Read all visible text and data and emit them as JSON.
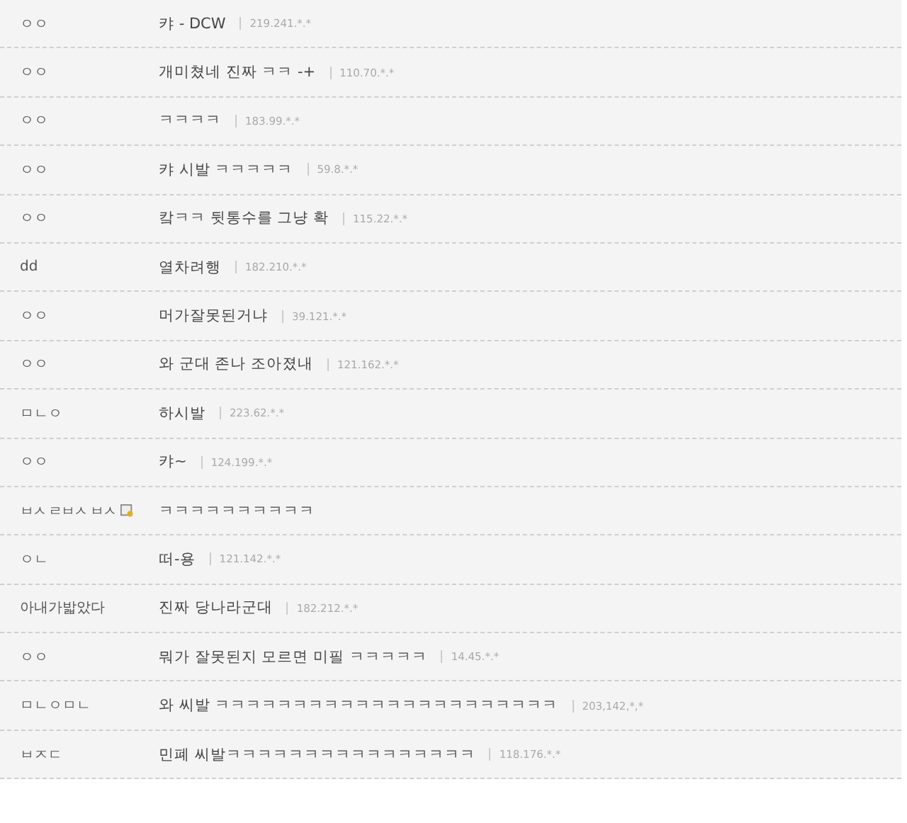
{
  "comments": [
    {
      "nickname": "ㅇㅇ",
      "text": "캬 - DCW",
      "ip": "219.241.*.*"
    },
    {
      "nickname": "ㅇㅇ",
      "text": "개미쳤네 진짜 ㅋㅋ -+",
      "ip": "110.70.*.*"
    },
    {
      "nickname": "ㅇㅇ",
      "text": "ㅋㅋㅋㅋ",
      "ip": "183.99.*.*"
    },
    {
      "nickname": "ㅇㅇ",
      "text": "캬 시발 ㅋㅋㅋㅋㅋ",
      "ip": "59.8.*.*"
    },
    {
      "nickname": "ㅇㅇ",
      "text": "캌ㅋㅋ 뒷통수를 그냥 확",
      "ip": "115.22.*.*"
    },
    {
      "nickname": "dd",
      "text": "열차려행",
      "ip": "182.210.*.*"
    },
    {
      "nickname": "ㅇㅇ",
      "text": "머가잘못된거냐",
      "ip": "39.121.*.*"
    },
    {
      "nickname": "ㅇㅇ",
      "text": "와 군대 존나 조아졌내",
      "ip": "121.162.*.*"
    },
    {
      "nickname": "ㅁㄴㅇ",
      "text": "하시발",
      "ip": "223.62.*.*"
    },
    {
      "nickname": "ㅇㅇ",
      "text": "캬~",
      "ip": "124.199.*.*"
    },
    {
      "nickname": "ㅂㅅ ㄹㅂㅅ ㅂㅅ",
      "member": true,
      "text": "ㅋㅋㅋㅋㅋㅋㅋㅋㅋㅋ"
    },
    {
      "nickname": "ㅇㄴ",
      "text": "떠-용",
      "ip": "121.142.*.*"
    },
    {
      "nickname": "아내가밟았다",
      "text": "진짜 당나라군대",
      "ip": "182.212.*.*"
    },
    {
      "nickname": "ㅇㅇ",
      "text": "뭐가 잘못된지 모르면 미필 ㅋㅋㅋㅋㅋ",
      "ip": "14.45.*.*"
    },
    {
      "nickname": "ㅁㄴㅇㅁㄴ",
      "text": "와 씨발 ㅋㅋㅋㅋㅋㅋㅋㅋㅋㅋㅋㅋㅋㅋㅋㅋㅋㅋㅋㅋㅋㅋ",
      "ip": "203,142,*,*"
    },
    {
      "nickname": "ㅂㅈㄷ",
      "text": "민폐 씨발ㅋㅋㅋㅋㅋㅋㅋㅋㅋㅋㅋㅋㅋㅋㅋㅋ",
      "ip": "118.176.*.*"
    }
  ]
}
